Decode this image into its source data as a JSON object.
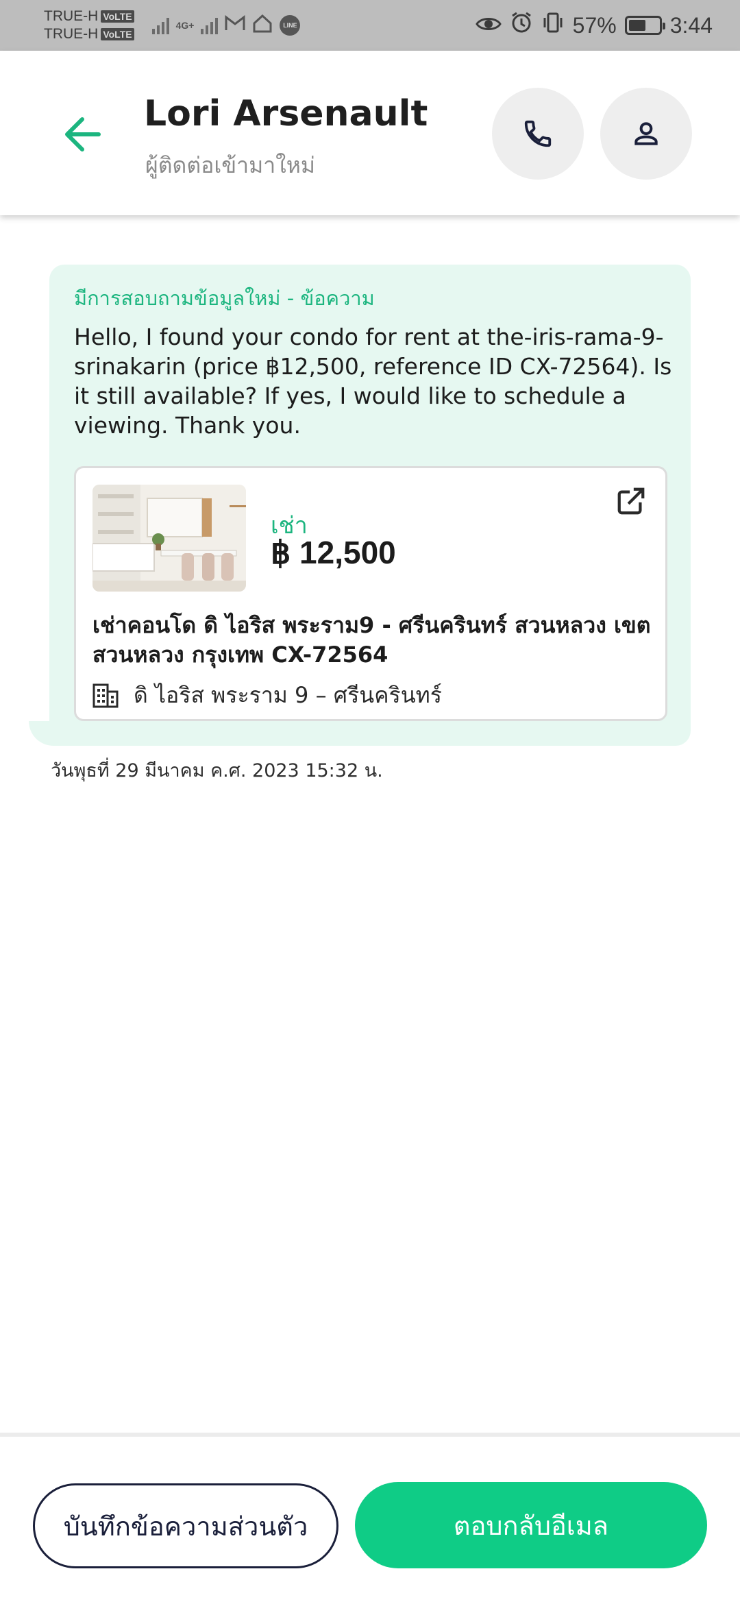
{
  "status_bar": {
    "carrier_1": "TRUE-H",
    "carrier_2": "TRUE-H",
    "volte_label": "VoLTE",
    "network_label": "4G+",
    "line_label": "LINE",
    "battery": "57%",
    "battery_level": 0.57,
    "time": "3:44"
  },
  "header": {
    "contact_name": "Lori Arsenault",
    "contact_subtitle": "ผู้ติดต่อเข้ามาใหม่",
    "accent_color": "#1cb57f"
  },
  "message": {
    "heading": "มีการสอบถามข้อมูลใหม่ - ข้อความ",
    "body": "Hello, I found your condo for rent at the-iris-rama-9-srinakarin (price ฿12,500, reference ID CX-72564). Is it still available? If yes, I would like to schedule a viewing. Thank you.",
    "timestamp": "วันพุธที่ 29 มีนาคม ค.ศ. 2023 15:32 น."
  },
  "listing": {
    "type": "เช่า",
    "price": "฿ 12,500",
    "title": "เช่าคอนโด  ดิ ไอริส พระราม9 - ศรีนครินทร์ สวนหลวง เขต สวนหลวง กรุงเทพ CX-72564",
    "project": "ดิ ไอริส พระราม 9 – ศรีนครินทร์"
  },
  "actions": {
    "private_note": "บันทึกข้อความส่วนตัว",
    "reply_email": "ตอบกลับอีเมล",
    "reply_color": "#0fcc86"
  },
  "icons": {
    "back": "arrow-left-icon",
    "call": "phone-icon",
    "profile": "person-icon",
    "open_external": "open-in-new-icon",
    "building": "building-icon"
  }
}
